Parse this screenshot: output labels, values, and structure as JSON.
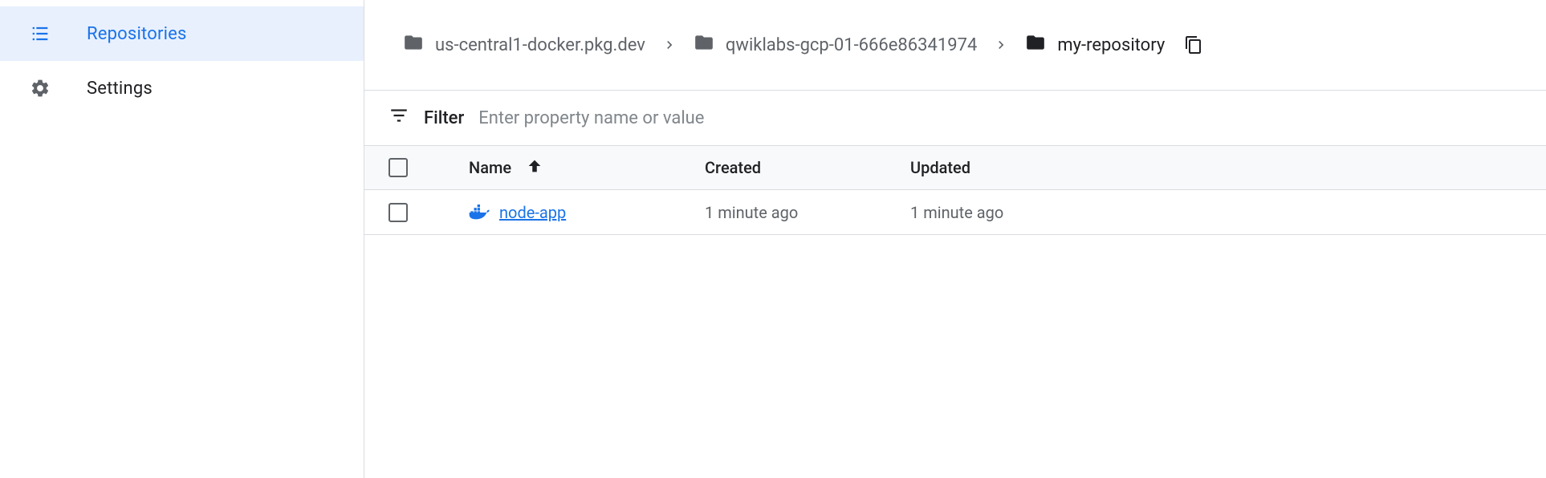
{
  "sidebar": {
    "items": [
      {
        "label": "Repositories"
      },
      {
        "label": "Settings"
      }
    ]
  },
  "breadcrumb": {
    "items": [
      {
        "label": "us-central1-docker.pkg.dev"
      },
      {
        "label": "qwiklabs-gcp-01-666e86341974"
      },
      {
        "label": "my-repository"
      }
    ]
  },
  "filter": {
    "label": "Filter",
    "placeholder": "Enter property name or value"
  },
  "table": {
    "headers": {
      "name": "Name",
      "created": "Created",
      "updated": "Updated"
    },
    "rows": [
      {
        "name": "node-app",
        "created": "1 minute ago",
        "updated": "1 minute ago"
      }
    ]
  }
}
